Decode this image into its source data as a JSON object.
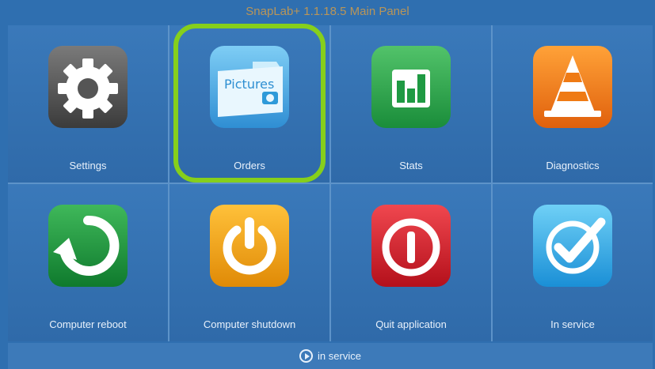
{
  "window": {
    "title": "SnapLab+ 1.1.18.5 Main Panel"
  },
  "tiles": [
    {
      "label": "Settings",
      "icon": "gear-icon"
    },
    {
      "label": "Orders",
      "icon": "pictures-folder-icon",
      "icon_text": "Pictures",
      "highlighted": true
    },
    {
      "label": "Stats",
      "icon": "bar-chart-icon"
    },
    {
      "label": "Diagnostics",
      "icon": "traffic-cone-icon"
    },
    {
      "label": "Computer reboot",
      "icon": "reboot-arrow-icon"
    },
    {
      "label": "Computer shutdown",
      "icon": "power-icon"
    },
    {
      "label": "Quit application",
      "icon": "quit-icon"
    },
    {
      "label": "In service",
      "icon": "checkmark-icon"
    }
  ],
  "footer": {
    "status": "in service",
    "icon": "play-circle-icon"
  },
  "colors": {
    "background": "#2f6fb0",
    "highlight": "#86cf1c",
    "title": "#e6a23c"
  }
}
